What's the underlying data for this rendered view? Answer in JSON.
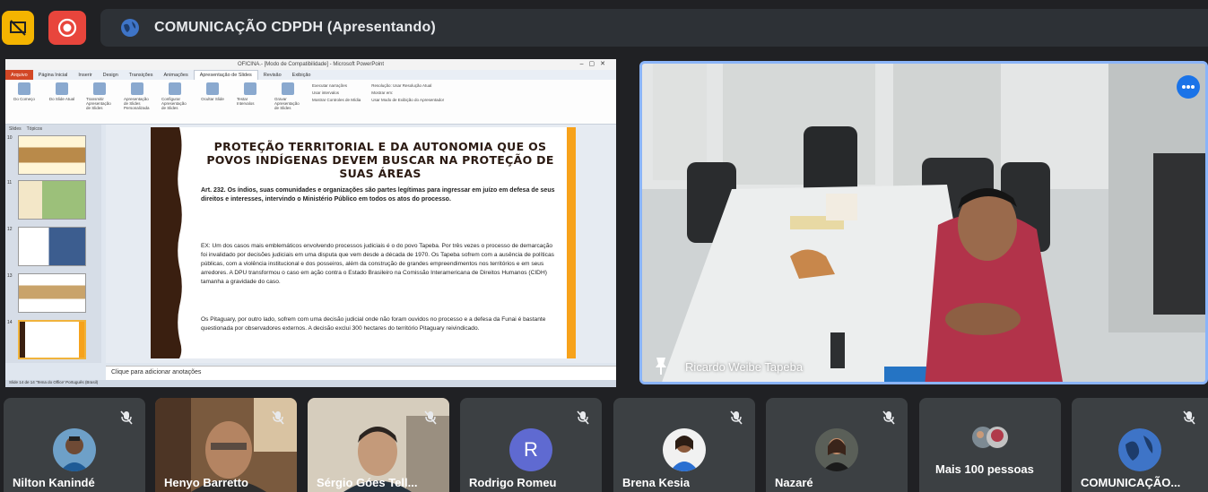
{
  "meeting": {
    "presentation_title": "COMUNICAÇÃO CDPDH (Apresentando)",
    "accent": "#8ab4f8",
    "record_color": "#e8453c",
    "present_color": "#f4b400"
  },
  "toolbar": {
    "stop_presenting_icon": "present-off-icon",
    "record_icon": "record-icon"
  },
  "shared_screen": {
    "window_title": "OFICINA.- [Modo de Compatibilidade] - Microsoft PowerPoint",
    "tabs": [
      "Arquivo",
      "Página Inicial",
      "Inserir",
      "Design",
      "Transições",
      "Animações",
      "Apresentação de Slides",
      "Revisão",
      "Exibição"
    ],
    "active_tab": "Apresentação de Slides",
    "ribbon": {
      "groups": [
        "Do Começo",
        "Do Slide Atual",
        "Transmitir Apresentação de Slides",
        "Apresentação de Slides Personalizada",
        "Configurar Apresentação de Slides",
        "Ocultar Slide",
        "Testar Intervalos",
        "Gravar Apresentação de Slides"
      ],
      "options": [
        "Executar narrações",
        "Usar intervalos",
        "Mostrar Controles de Mídia",
        "Resolução: Usar Resolução Atual",
        "Mostrar em:",
        "Usar Modo de Exibição do Apresentador"
      ]
    },
    "thumb_tabs": [
      "Slides",
      "Tópicos"
    ],
    "thumb_numbers": [
      "10",
      "11",
      "12",
      "13",
      "14"
    ],
    "slide": {
      "title": "PROTEÇÃO TERRITORIAL E DA AUTONOMIA QUE OS POVOS INDÍGENAS DEVEM BUSCAR NA PROTEÇÃO DE SUAS ÁREAS",
      "bullet1": "Art. 232. Os índios, suas comunidades e organizações são partes legítimas para ingressar em juízo em defesa de seus direitos e interesses, intervindo o Ministério Público em todos os atos do processo.",
      "bullet2": "EX: Um dos casos mais emblemáticos envolvendo processos judiciais é o do povo Tapeba. Por três vezes o processo de demarcação foi invalidado por decisões judiciais em uma disputa que vem desde a década de 1970. Os Tapeba sofrem com a ausência de políticas públicas, com a violência institucional e dos posseiros, além da construção de grandes empreendimentos nos territórios e em seus arredores. A DPU transformou o caso em ação contra o Estado Brasileiro na Comissão Interamericana de Direitos Humanos (CIDH) tamanha a gravidade do caso.",
      "bullet3": "Os Pitaguary, por outro lado, sofrem com uma decisão judicial onde não foram ouvidos no processo e a defesa da Funai é bastante questionada por observadores externos. A decisão exclui 300 hectares do território Pitaguary reivindicado."
    },
    "notes_placeholder": "Clique para adicionar anotações",
    "status_left": "Slide 14 de 14   'Tema do Office'   Português (Brasil)",
    "slide_colors": {
      "left_bar": "#3a1f10",
      "right_bar": "#f7a21b"
    }
  },
  "speaker": {
    "name": "Ricardo Weibe Tapeba",
    "pin_icon": "pin-icon",
    "more_icon": "more-options-icon"
  },
  "participants": [
    {
      "name": "Nilton Kanindé",
      "type": "avatar-photo",
      "muted": true
    },
    {
      "name": "Henyo Barretto",
      "type": "video",
      "muted": true
    },
    {
      "name": "Sérgio Góes Tell...",
      "type": "video",
      "muted": true
    },
    {
      "name": "Rodrigo Romeu",
      "type": "letter",
      "letter": "R",
      "muted": true
    },
    {
      "name": "Brena Kesia",
      "type": "avatar-photo",
      "muted": true
    },
    {
      "name": "Nazaré",
      "type": "avatar-photo",
      "muted": true
    },
    {
      "name": "Mais 100 pessoas",
      "type": "group",
      "muted": false
    },
    {
      "name": "COMUNICAÇÃO...",
      "type": "avatar-photo",
      "muted": true
    }
  ]
}
